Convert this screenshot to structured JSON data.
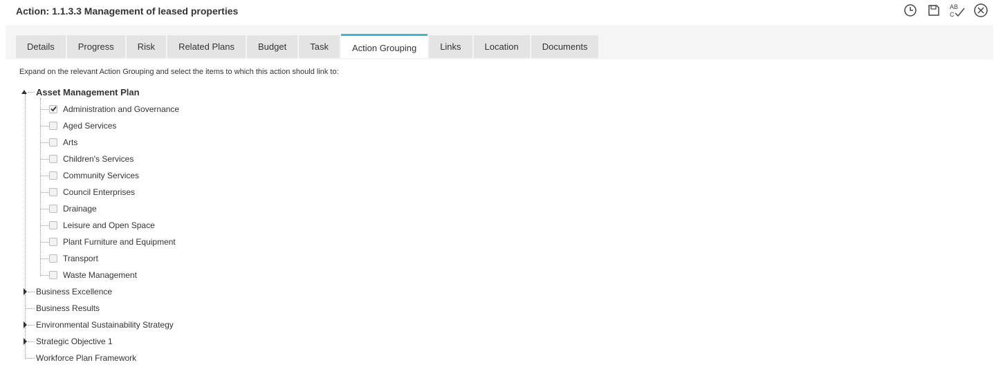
{
  "window": {
    "title": "Action: 1.1.3.3 Management of leased properties",
    "toolbar_icons": [
      "history-icon",
      "save-icon",
      "spellcheck-icon",
      "close-icon"
    ]
  },
  "tabs": [
    {
      "label": "Details",
      "active": false
    },
    {
      "label": "Progress",
      "active": false
    },
    {
      "label": "Risk",
      "active": false
    },
    {
      "label": "Related Plans",
      "active": false
    },
    {
      "label": "Budget",
      "active": false
    },
    {
      "label": "Task",
      "active": false
    },
    {
      "label": "Action Grouping",
      "active": true
    },
    {
      "label": "Links",
      "active": false
    },
    {
      "label": "Location",
      "active": false
    },
    {
      "label": "Documents",
      "active": false
    }
  ],
  "instructions": "Expand on the relevant Action Grouping and select the items to which this action should link to:",
  "tree": {
    "root": {
      "label": "Asset Management Plan",
      "expanded": true,
      "children": [
        {
          "label": "Administration and Governance",
          "checked": true
        },
        {
          "label": "Aged Services",
          "checked": false
        },
        {
          "label": "Arts",
          "checked": false
        },
        {
          "label": "Children's Services",
          "checked": false
        },
        {
          "label": "Community Services",
          "checked": false
        },
        {
          "label": "Council Enterprises",
          "checked": false
        },
        {
          "label": "Drainage",
          "checked": false
        },
        {
          "label": "Leisure and Open Space",
          "checked": false
        },
        {
          "label": "Plant Furniture and Equipment",
          "checked": false
        },
        {
          "label": "Transport",
          "checked": false
        },
        {
          "label": "Waste Management",
          "checked": false
        }
      ]
    },
    "others": [
      {
        "label": "Business Excellence",
        "expandable": true
      },
      {
        "label": "Business Results",
        "expandable": false
      },
      {
        "label": "Environmental Sustainability Strategy",
        "expandable": true
      },
      {
        "label": "Strategic Objective 1",
        "expandable": true
      },
      {
        "label": "Workforce Plan Framework",
        "expandable": false
      }
    ]
  },
  "colors": {
    "accent": "#3fb5d3",
    "tab_bg": "#e4e4e4",
    "tabbar_bg": "#f5f5f5"
  }
}
